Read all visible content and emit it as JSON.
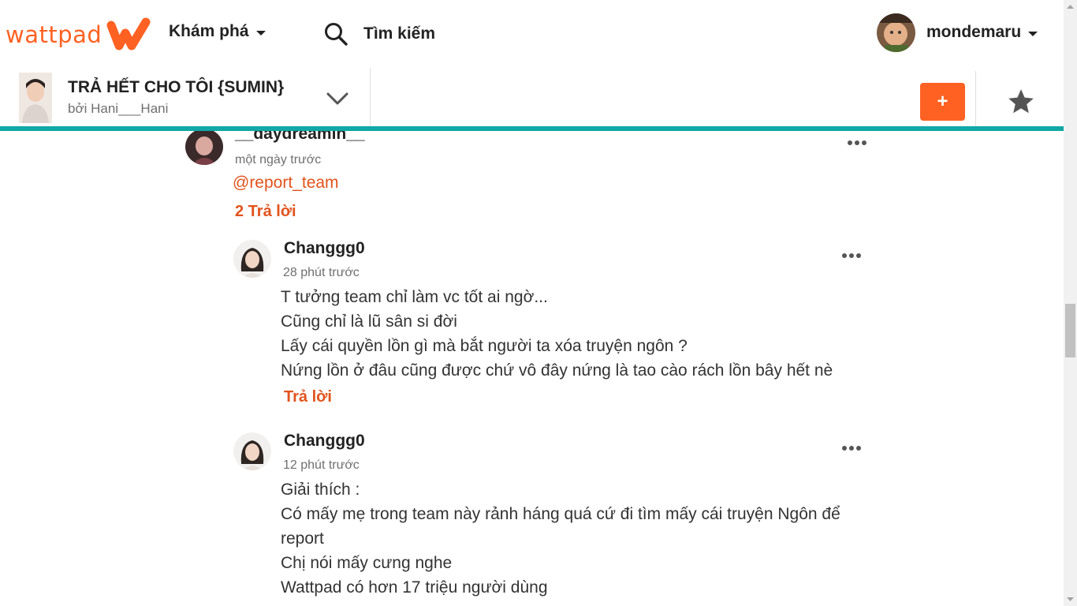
{
  "nav": {
    "logo_text": "wattpad",
    "explore_label": "Khám phá",
    "search_label": "Tìm kiếm",
    "username": "mondemaru"
  },
  "story": {
    "title": "TRẢ HẾT CHO TÔI {SUMIN}",
    "author": "bởi Hani___Hani",
    "add_label": "+"
  },
  "comments": {
    "parent": {
      "name": "__daydreamin__",
      "time": "một ngày trước",
      "mention": "@report_team",
      "replies_label": "2 Trả lời"
    },
    "replies": [
      {
        "name": "Changgg0",
        "time": "28 phút trước",
        "lines": [
          "T tưởng team chỉ làm vc tốt ai ngờ...",
          "Cũng chỉ là lũ sân si đời",
          "Lấy cái quyền lồn gì mà bắt người ta xóa truyện ngôn ?",
          "Nứng lồn ở đâu cũng được chứ vô đây nứng là tao cào rách lồn bây hết nè"
        ],
        "reply_label": "Trả lời"
      },
      {
        "name": "Changgg0",
        "time": "12 phút trước",
        "lines": [
          "Giải thích :",
          "Có mấy mẹ trong team này rảnh háng quá cứ đi tìm mấy cái truyện Ngôn để",
          "report",
          "Chị nói mấy cưng nghe",
          "Wattpad có hơn 17 triệu người dùng"
        ]
      }
    ]
  },
  "colors": {
    "brand": "#ff6122",
    "accent_line": "#11a8a5",
    "link": "#e2531c"
  },
  "icons": [
    "wattpad-w-logo-icon",
    "search-icon",
    "chevron-down-icon",
    "star-icon",
    "more-options-icon"
  ]
}
